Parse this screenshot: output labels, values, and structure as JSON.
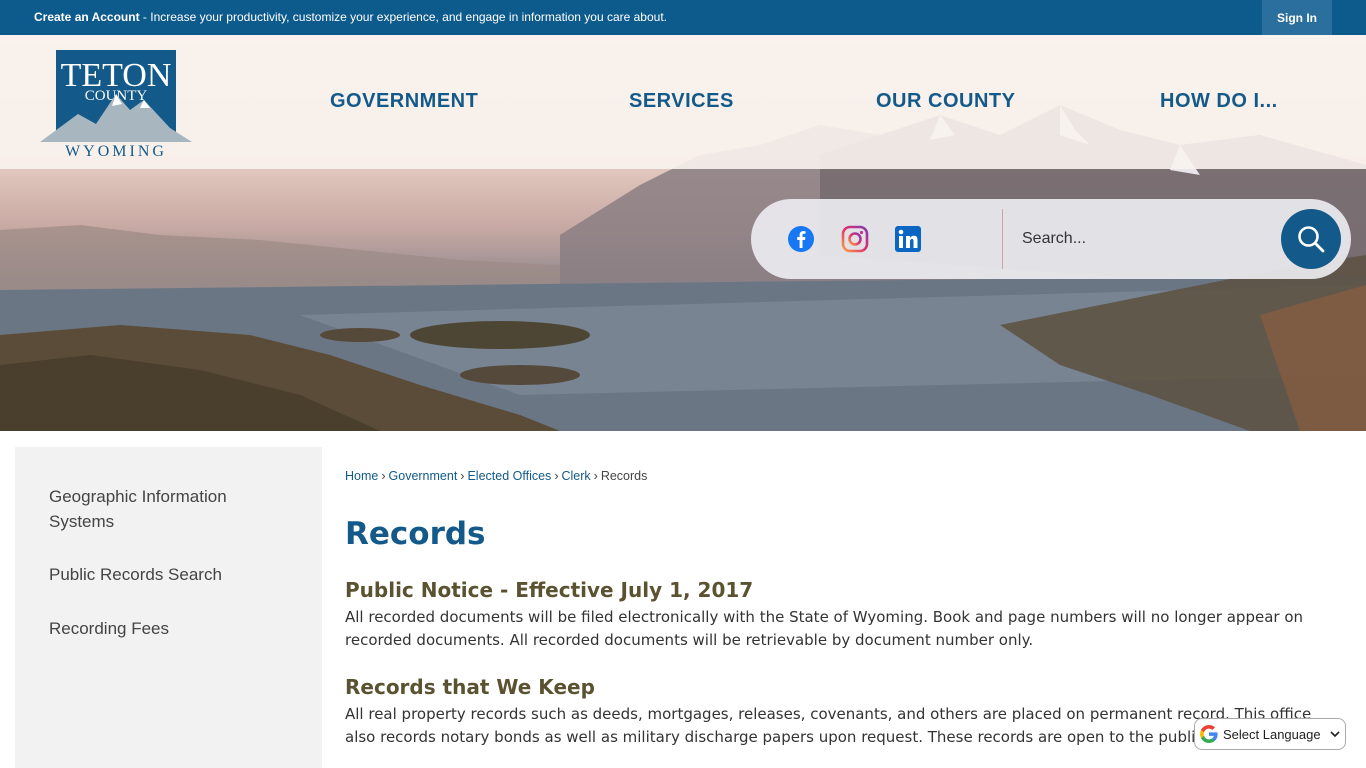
{
  "topbar": {
    "create_account": "Create an Account",
    "message": " - Increase your productivity, customize your experience, and engage in information you care about.",
    "sign_in": "Sign In"
  },
  "logo": {
    "line1": "TETON",
    "line2": "COUNTY",
    "line3": "WYOMING"
  },
  "nav": {
    "items": [
      {
        "label": "GOVERNMENT"
      },
      {
        "label": "SERVICES"
      },
      {
        "label": "OUR COUNTY"
      },
      {
        "label": "HOW DO I..."
      }
    ]
  },
  "social": {
    "icons": [
      "facebook-icon",
      "instagram-icon",
      "linkedin-icon"
    ]
  },
  "search": {
    "placeholder": "Search..."
  },
  "sidebar": {
    "items": [
      {
        "label": "Geographic Information Systems"
      },
      {
        "label": "Public Records Search"
      },
      {
        "label": "Recording Fees"
      }
    ]
  },
  "breadcrumb": {
    "items": [
      "Home",
      "Government",
      "Elected Offices",
      "Clerk"
    ],
    "current": "Records"
  },
  "main": {
    "title": "Records",
    "sections": [
      {
        "heading": "Public Notice - Effective July 1, 2017",
        "body": "All recorded documents will be filed electronically with the State of Wyoming. Book and page numbers will no longer appear on recorded documents. All recorded documents will be retrievable by document number only."
      },
      {
        "heading": "Records that We Keep",
        "body": " All real property records such as deeds, mortgages, releases, covenants, and others are placed on permanent record. This office also records notary bonds as well as military discharge papers upon request. These records are open to the public."
      }
    ]
  },
  "translate": {
    "label": "Select Language"
  },
  "colors": {
    "primary": "#135a8a",
    "topbar": "#0d5a8c",
    "heading": "#5a5230"
  }
}
